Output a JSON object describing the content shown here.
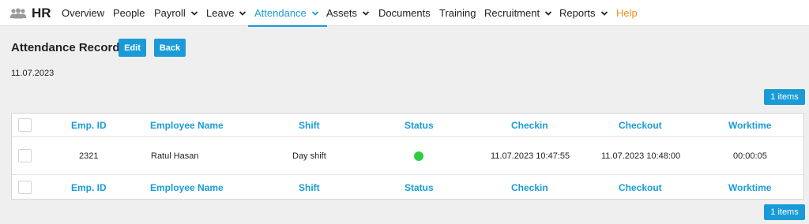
{
  "nav": {
    "brand": "HR",
    "items": [
      {
        "label": "Overview",
        "dropdown": false
      },
      {
        "label": "People",
        "dropdown": false
      },
      {
        "label": "Payroll",
        "dropdown": true
      },
      {
        "label": "Leave",
        "dropdown": true
      },
      {
        "label": "Attendance",
        "dropdown": true,
        "active": true
      },
      {
        "label": "Assets",
        "dropdown": true
      },
      {
        "label": "Documents",
        "dropdown": false
      },
      {
        "label": "Training",
        "dropdown": false
      },
      {
        "label": "Recruitment",
        "dropdown": true
      },
      {
        "label": "Reports",
        "dropdown": true
      },
      {
        "label": "Help",
        "dropdown": false
      }
    ]
  },
  "page": {
    "title": "Attendance Record",
    "edit_label": "Edit",
    "back_label": "Back",
    "date": "11.07.2023",
    "count_label": "1 items"
  },
  "table": {
    "columns": [
      "Emp. ID",
      "Employee Name",
      "Shift",
      "Status",
      "Checkin",
      "Checkout",
      "Worktime"
    ],
    "rows": [
      {
        "emp_id": "2321",
        "name": "Ratul Hasan",
        "shift": "Day shift",
        "status": "present",
        "checkin": "11.07.2023 10:47:55",
        "checkout": "11.07.2023 10:48:00",
        "worktime": "00:00:05"
      }
    ]
  },
  "colors": {
    "accent": "#1a9bd7",
    "help": "#ff8c1a",
    "status_present": "#2ecc40"
  }
}
